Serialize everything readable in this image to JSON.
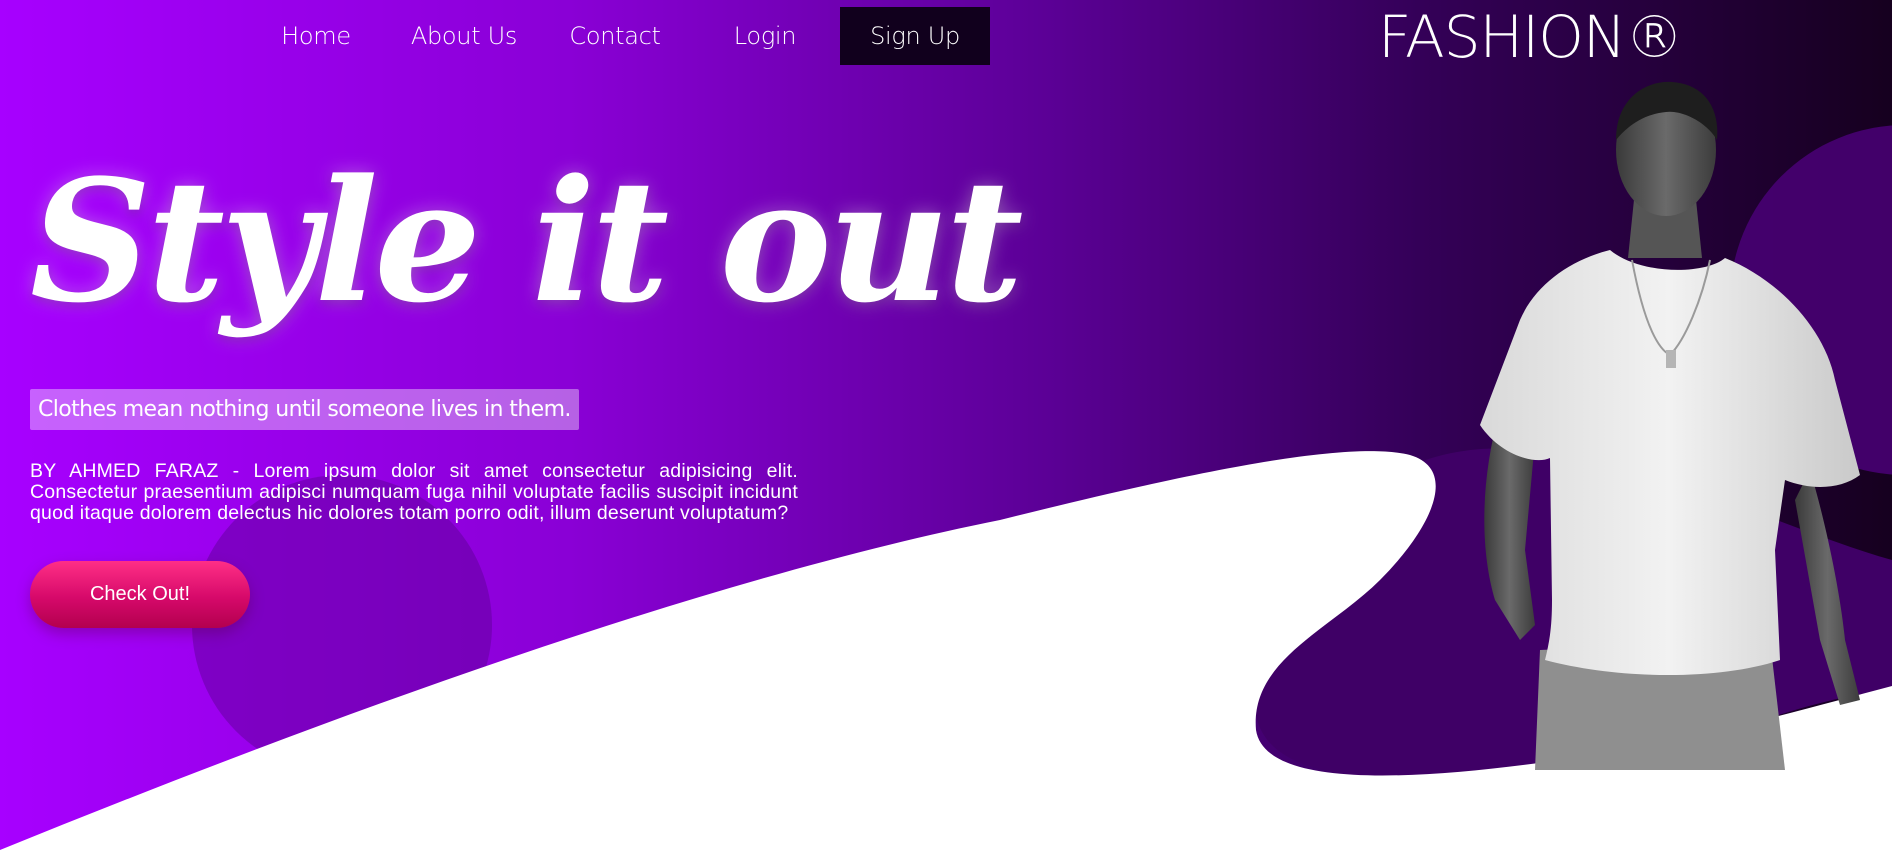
{
  "nav": {
    "items": [
      {
        "label": "Home"
      },
      {
        "label": "About Us"
      },
      {
        "label": "Contact"
      },
      {
        "label": "Login"
      },
      {
        "label": "Sign Up"
      }
    ]
  },
  "brand": {
    "logo": "FASHION®"
  },
  "hero": {
    "title": "Style it out",
    "tagline": "Clothes mean nothing until someone lives in them.",
    "body": "BY AHMED FARAZ - Lorem ipsum dolor sit amet consectetur adipisicing elit. Consectetur praesentium adipisci numquam fuga nihil voluptate facilis suscipit incidunt quod itaque dolorem delectus hic dolores totam porro odit, illum deserunt voluptatum?",
    "cta_label": "Check Out!"
  },
  "colors": {
    "gradient_start": "#a700ff",
    "gradient_end": "#16001f",
    "cta": "#e0156f",
    "signup_bg": "#11001d"
  },
  "icons": {
    "model": "person-photo"
  }
}
